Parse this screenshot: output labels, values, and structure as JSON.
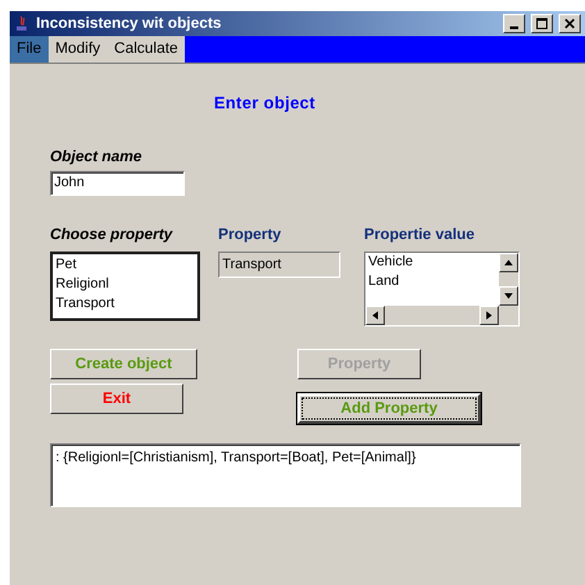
{
  "window": {
    "title": "Inconsistency wit objects"
  },
  "menu": [
    {
      "label": "File",
      "selected": true
    },
    {
      "label": "Modify",
      "selected": false
    },
    {
      "label": "Calculate",
      "selected": false
    }
  ],
  "heading": "Enter object",
  "object_name": {
    "label": "Object name",
    "value": "John"
  },
  "choose_property": {
    "label": "Choose property",
    "items": [
      "Pet",
      "Religionl",
      "Transport"
    ]
  },
  "property": {
    "label": "Property",
    "value": "Transport"
  },
  "property_value": {
    "label": "Propertie value",
    "items": [
      "Vehicle",
      "Land"
    ]
  },
  "buttons": [
    {
      "label": "Create object",
      "kind": "create",
      "disabled": false,
      "focused": false
    },
    {
      "label": "Exit",
      "kind": "exit",
      "disabled": false,
      "focused": false
    },
    {
      "label": "Property",
      "kind": "property",
      "disabled": true,
      "focused": false
    },
    {
      "label": "Add Property",
      "kind": "add",
      "disabled": false,
      "focused": true
    }
  ],
  "output": ": {Religionl=[Christianism], Transport=[Boat], Pet=[Animal]}"
}
